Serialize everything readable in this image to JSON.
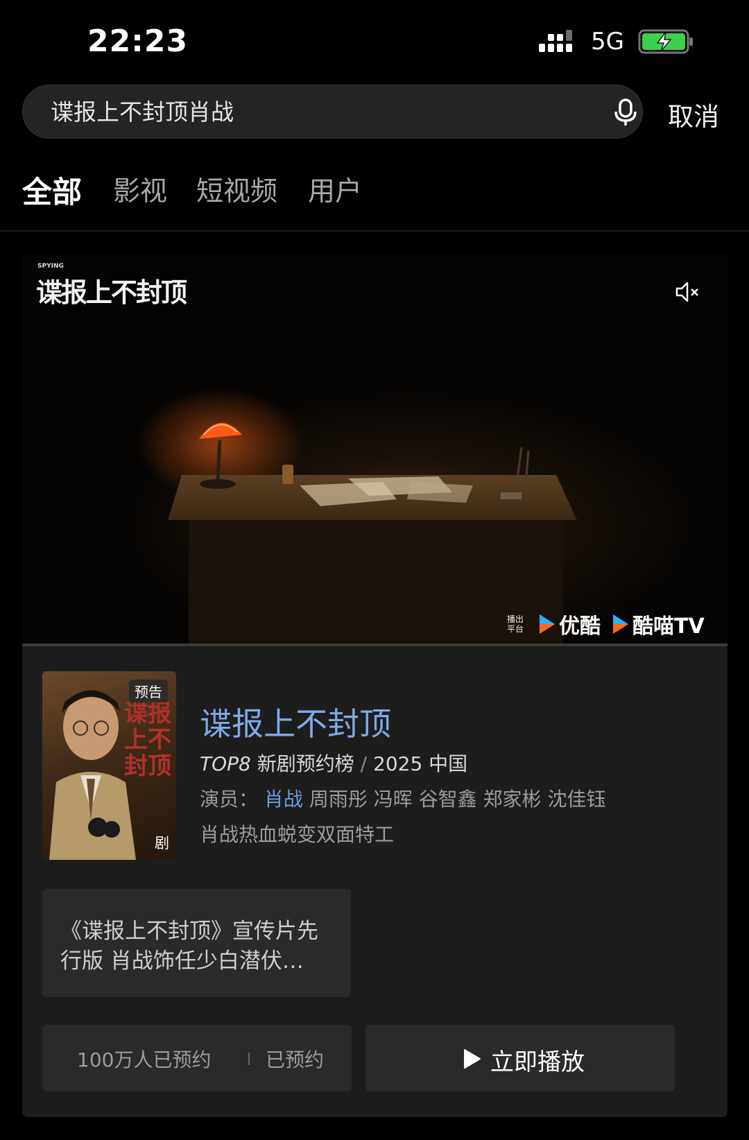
{
  "status_bar": {
    "time": "22:23",
    "network": "5G"
  },
  "search": {
    "query": "谍报上不封顶肖战",
    "cancel_label": "取消"
  },
  "tabs": [
    {
      "label": "全部",
      "active": true
    },
    {
      "label": "影视",
      "active": false
    },
    {
      "label": "短视频",
      "active": false
    },
    {
      "label": "用户",
      "active": false
    }
  ],
  "video": {
    "logo_en": "SPYING",
    "logo_text": "谍报上不封顶",
    "platform_label_1": "播出",
    "platform_label_2": "平台",
    "platforms": [
      "优酷",
      "酷喵TV"
    ]
  },
  "show": {
    "poster_badge": "预告",
    "poster_type": "剧",
    "poster_art_text": "谍报上不封顶",
    "title": "谍报上不封顶",
    "rank": "TOP8",
    "rank_list": "新剧预约榜",
    "separator": "/",
    "year_region": "2025 中国",
    "cast_label": "演员：",
    "cast_lead": "肖战",
    "cast_others": "周雨彤 冯晖 谷智鑫 郑家彬 沈佳钰",
    "tagline": "肖战热血蜕变双面特工"
  },
  "clip": {
    "title": "《谍报上不封顶》宣传片先行版 肖战饰任少白潜伏…"
  },
  "actions": {
    "reserve_count": "100万人已预约",
    "reserve_status": "已预约",
    "play_label": "立即播放"
  },
  "colors": {
    "accent_blue": "#7fa9e6",
    "battery_green": "#3cd24a",
    "youku_blue": "#2ab0ff",
    "youku_orange": "#ff6a1a"
  }
}
